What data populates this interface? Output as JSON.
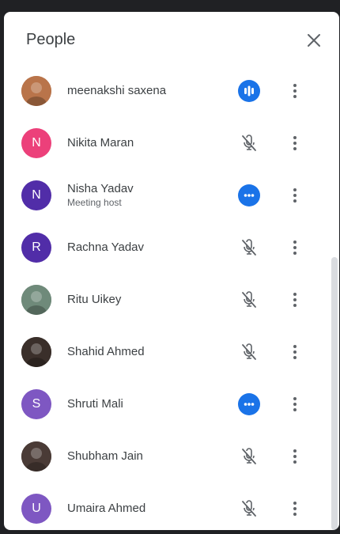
{
  "header": {
    "title": "People"
  },
  "participants": [
    {
      "name": "meenakshi saxena",
      "subtitle": "",
      "initial": "",
      "avatar_type": "photo",
      "avatar_color": "#b9744a",
      "mic_state": "speaking"
    },
    {
      "name": "Nikita Maran",
      "subtitle": "",
      "initial": "N",
      "avatar_type": "letter",
      "avatar_color": "#ec407a",
      "mic_state": "muted"
    },
    {
      "name": "Nisha Yadav",
      "subtitle": "Meeting host",
      "initial": "N",
      "avatar_type": "letter",
      "avatar_color": "#512da8",
      "mic_state": "options"
    },
    {
      "name": "Rachna Yadav",
      "subtitle": "",
      "initial": "R",
      "avatar_type": "letter",
      "avatar_color": "#512da8",
      "mic_state": "muted"
    },
    {
      "name": "Ritu Uikey",
      "subtitle": "",
      "initial": "",
      "avatar_type": "photo",
      "avatar_color": "#6f8a7a",
      "mic_state": "muted"
    },
    {
      "name": "Shahid Ahmed",
      "subtitle": "",
      "initial": "",
      "avatar_type": "photo",
      "avatar_color": "#3a2f2a",
      "mic_state": "muted"
    },
    {
      "name": "Shruti Mali",
      "subtitle": "",
      "initial": "S",
      "avatar_type": "letter",
      "avatar_color": "#7e57c2",
      "mic_state": "options"
    },
    {
      "name": "Shubham Jain",
      "subtitle": "",
      "initial": "",
      "avatar_type": "photo",
      "avatar_color": "#4a3b36",
      "mic_state": "muted"
    },
    {
      "name": "Umaira Ahmed",
      "subtitle": "",
      "initial": "U",
      "avatar_type": "letter",
      "avatar_color": "#7e57c2",
      "mic_state": "muted"
    }
  ],
  "icons": {
    "close": "close-icon",
    "more": "more-vert-icon",
    "muted": "mic-off-icon",
    "speaking": "audio-level-icon",
    "options": "more-horiz-icon"
  },
  "colors": {
    "accent": "#1a73e8",
    "text": "#3c4043",
    "icon": "#5f6368"
  }
}
